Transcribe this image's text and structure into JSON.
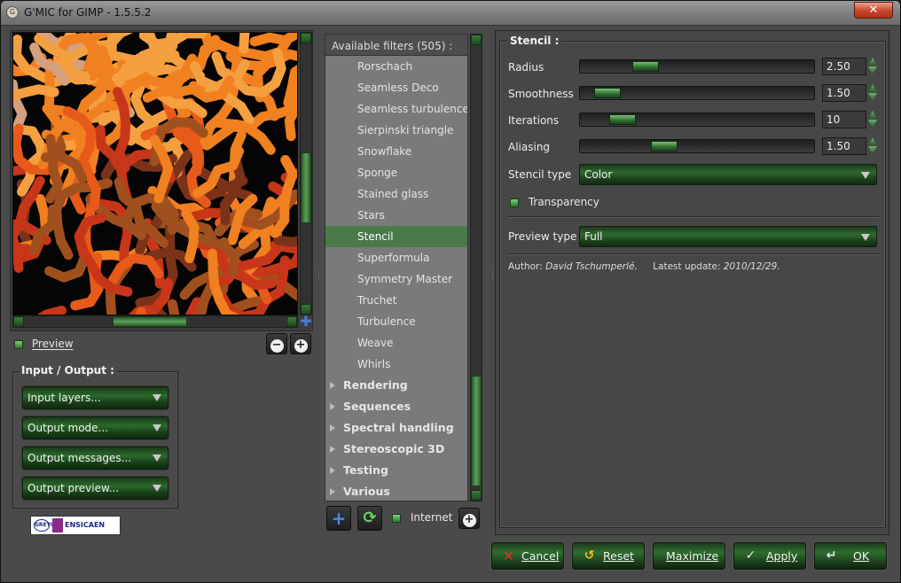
{
  "window": {
    "title": "G'MIC for GIMP - 1.5.5.2",
    "close_glyph": "✕"
  },
  "preview": {
    "checkbox_label": "Preview",
    "zoom_out_glyph": "−",
    "zoom_in_glyph": "+"
  },
  "io": {
    "group_title": "Input / Output :",
    "buttons": [
      "Input layers...",
      "Output mode...",
      "Output messages...",
      "Output preview..."
    ]
  },
  "logo": {
    "left_text": "GREYC",
    "right_text": "ENSICAEN"
  },
  "filters": {
    "header": "Available filters (505) :",
    "items": [
      "Rorschach",
      "Seamless Deco",
      "Seamless turbulence",
      "Sierpinski triangle",
      "Snowflake",
      "Sponge",
      "Stained glass",
      "Stars",
      "Stencil",
      "Superformula",
      "Symmetry Master",
      "Truchet",
      "Turbulence",
      "Weave",
      "Whirls"
    ],
    "selected": "Stencil",
    "categories": [
      "Rendering",
      "Sequences",
      "Spectral handling",
      "Stereoscopic 3D",
      "Testing",
      "Various"
    ],
    "add_glyph": "+",
    "refresh_glyph": "⟳",
    "internet_label": "Internet",
    "settings_glyph": "+"
  },
  "params": {
    "group_title": "Stencil :",
    "sliders": [
      {
        "label": "Radius",
        "value": "2.50",
        "level": 0.25
      },
      {
        "label": "Smoothness",
        "value": "1.50",
        "level": 0.07
      },
      {
        "label": "Iterations",
        "value": "10",
        "level": 0.14
      },
      {
        "label": "Aliasing",
        "value": "1.50",
        "level": 0.34
      }
    ],
    "stencil_type_label": "Stencil type",
    "stencil_type_value": "Color",
    "transparency_label": "Transparency",
    "preview_type_label": "Preview type",
    "preview_type_value": "Full",
    "author_label": "Author:",
    "author_name": "David Tschumperlé.",
    "update_label": "Latest update:",
    "update_date": "2010/12/29."
  },
  "bottom_buttons": {
    "cancel": "Cancel",
    "reset": "Reset",
    "maximize": "Maximize",
    "apply": "Apply",
    "ok": "OK"
  },
  "colors": {
    "accent_green": "#2f6a2f",
    "selected_row": "#4a7a4a",
    "pattern_palette": [
      "#e85a1a",
      "#c8361a",
      "#f08020",
      "#7a3318",
      "#a0501e",
      "#d4a080",
      "#f5a040",
      "#8a1a10"
    ]
  }
}
